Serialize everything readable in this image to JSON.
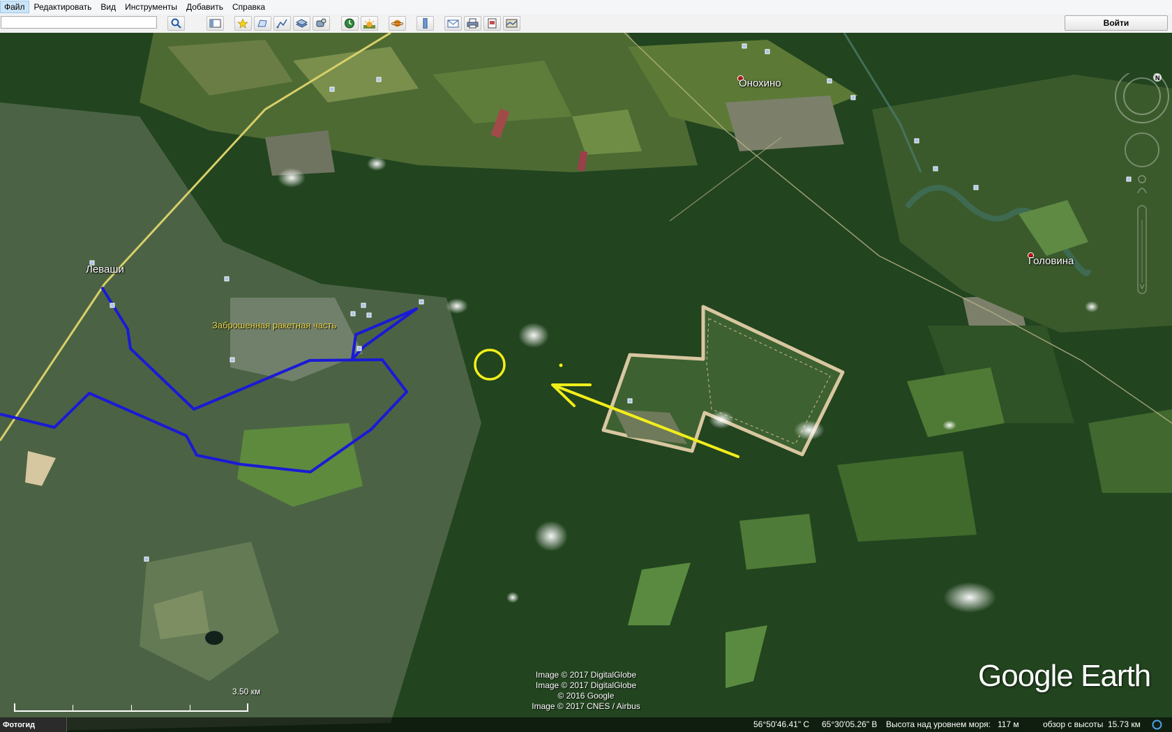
{
  "menu": {
    "items": [
      "Файл",
      "Редактировать",
      "Вид",
      "Инструменты",
      "Добавить",
      "Справка"
    ]
  },
  "toolbar": {
    "search_value": "",
    "signin_label": "Войти",
    "buttons": [
      "search-icon",
      "sidebar-icon",
      "placemark-icon",
      "polygon-icon",
      "path-icon",
      "overlay-icon",
      "tour-icon",
      "historical-imagery-icon",
      "sunlight-icon",
      "planets-icon",
      "ruler-icon",
      "email-icon",
      "print-icon",
      "save-image-icon",
      "maps-view-icon"
    ]
  },
  "map": {
    "places": [
      {
        "name": "Леваши"
      },
      {
        "name": "Онохино"
      },
      {
        "name": "Головина"
      }
    ],
    "poi_label": "Заброшенная ракетная часть",
    "credits": [
      "Image © 2017 DigitalGlobe",
      "Image © 2017 DigitalGlobe",
      "© 2016 Google",
      "Image © 2017 CNES / Airbus"
    ],
    "logo": "Google Earth",
    "scale_label": "3.50 км",
    "colors": {
      "route": "#1a1ad6",
      "annotation": "#f2ee1a",
      "road": "#d8cf6a"
    }
  },
  "status": {
    "tour_guide": "Фотогид",
    "latitude": "56°50'46.41\" С",
    "longitude": "65°30'05.26\" В",
    "elevation": "Высота над уровнем моря:   117 м",
    "eye_altitude": "обзор с высоты  15.73 км"
  }
}
